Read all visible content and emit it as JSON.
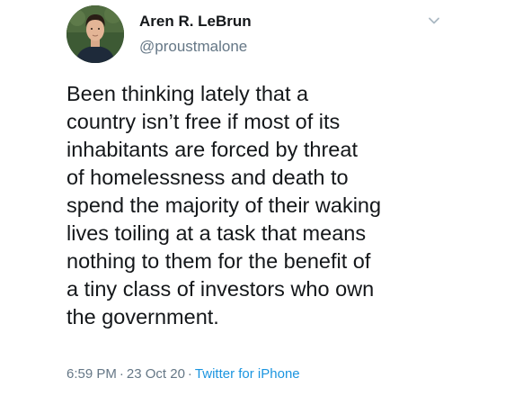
{
  "author": {
    "display_name": "Aren R. LeBrun",
    "handle": "@proustmalone",
    "avatar_icon": "profile-photo"
  },
  "menu_icon": "chevron-down-icon",
  "tweet": {
    "text": "Been thinking lately that a\ncountry isn’t free if most of its\ninhabitants are forced by threat\nof homelessness and death to\nspend the majority of their waking\nlives toiling at a task that means\nnothing to them for the benefit of\na tiny class of investors who own\nthe government."
  },
  "meta": {
    "time": "6:59 PM",
    "separator": "·",
    "date": "23 Oct 20",
    "source": "Twitter for iPhone"
  },
  "colors": {
    "text": "#14171a",
    "secondary": "#657786",
    "link": "#1b95e0",
    "background": "#ffffff"
  }
}
